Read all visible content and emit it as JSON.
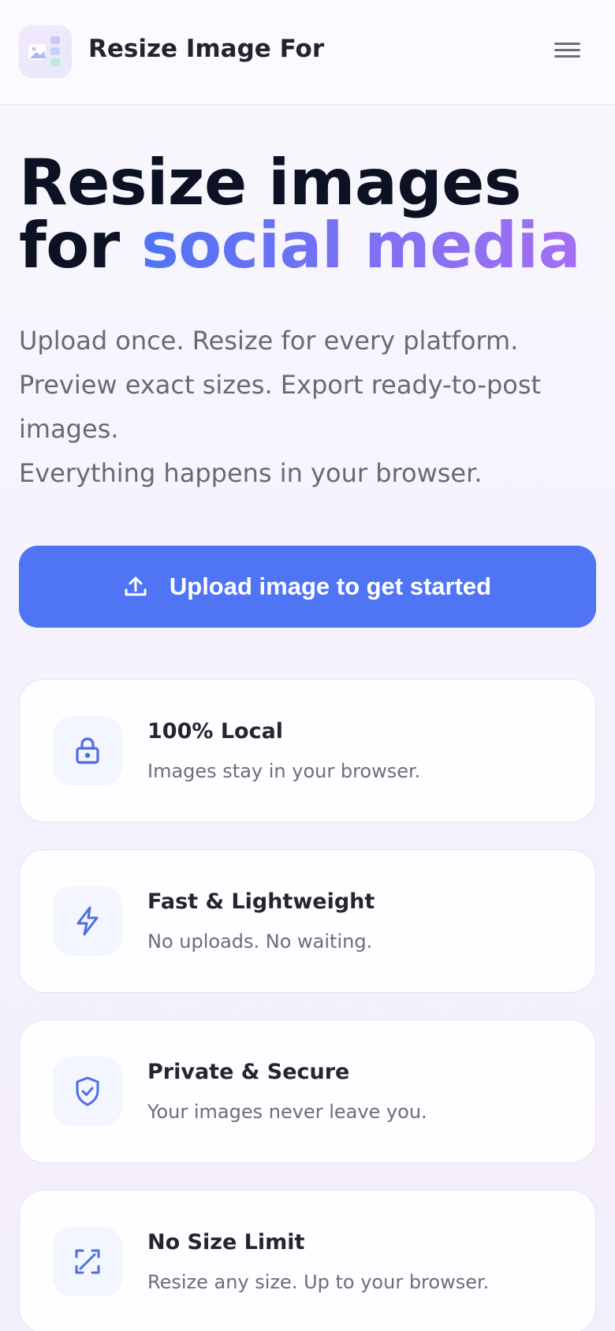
{
  "header": {
    "brand": "Resize Image For",
    "logo_icon": "image-layout-icon",
    "menu_icon": "hamburger-menu-icon"
  },
  "hero": {
    "title_line1": "Resize images",
    "title_prefix": "for ",
    "title_highlight": "social media",
    "subtitle_line1": "Upload once. Resize for every platform.",
    "subtitle_line2": "Preview exact sizes. Export ready-to-post images.",
    "subtitle_line3": "Everything happens in your browser."
  },
  "cta": {
    "label": "Upload image to get started",
    "icon": "upload-icon"
  },
  "features": [
    {
      "title": "100% Local",
      "desc": "Images stay in your browser.",
      "icon": "lock-icon"
    },
    {
      "title": "Fast & Lightweight",
      "desc": "No uploads. No waiting.",
      "icon": "lightning-icon"
    },
    {
      "title": "Private & Secure",
      "desc": "Your images never leave you.",
      "icon": "shield-check-icon"
    },
    {
      "title": "No Size Limit",
      "desc": "Resize any size. Up to your browser.",
      "icon": "expand-arrows-icon"
    }
  ],
  "colors": {
    "accent": "#4f75f5",
    "gradient_start": "#4f74f4",
    "gradient_end": "#a66ef2",
    "heading": "#0c1224",
    "muted_text": "#666a78"
  }
}
